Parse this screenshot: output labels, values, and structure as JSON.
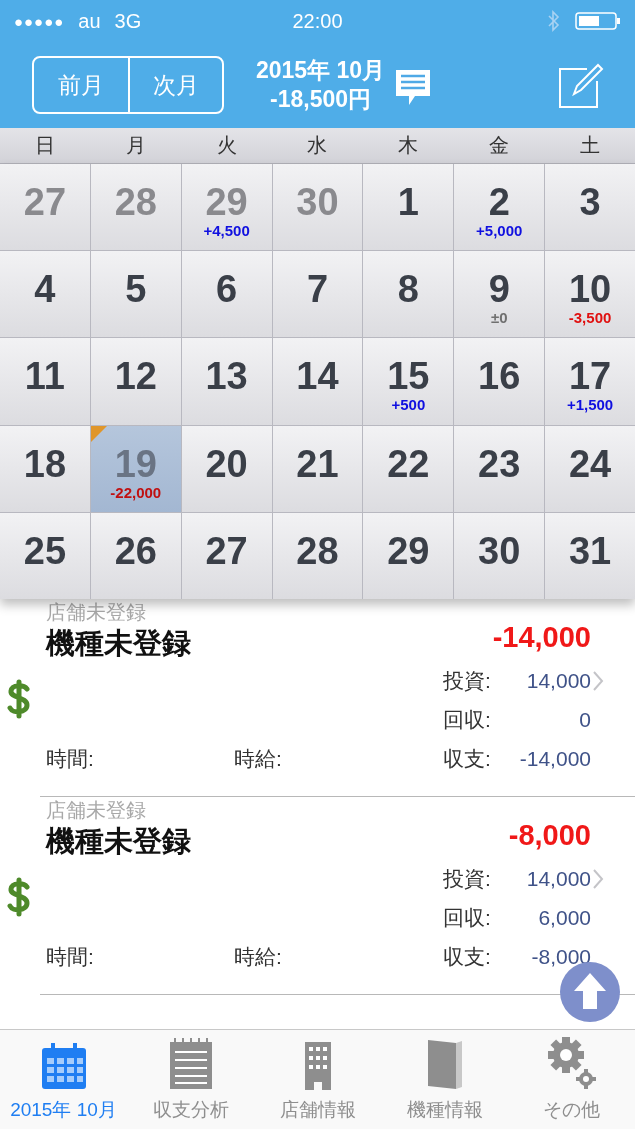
{
  "status_bar": {
    "signal_dots": "●●●●●",
    "carrier": "au",
    "network": "3G",
    "time": "22:00"
  },
  "nav": {
    "prev_button": "前月",
    "next_button": "次月",
    "month": "2015年 10月",
    "total": "-18,500円"
  },
  "weekdays": [
    "日",
    "月",
    "火",
    "水",
    "木",
    "金",
    "土"
  ],
  "days": [
    {
      "day": "27",
      "in_month": false,
      "selected": false,
      "marked": false
    },
    {
      "day": "28",
      "in_month": false,
      "selected": false,
      "marked": false
    },
    {
      "day": "29",
      "in_month": false,
      "selected": false,
      "marked": false,
      "amount": "+4,500",
      "color": "#1010e0"
    },
    {
      "day": "30",
      "in_month": false,
      "selected": false,
      "marked": false
    },
    {
      "day": "1",
      "in_month": true,
      "selected": false,
      "marked": false
    },
    {
      "day": "2",
      "in_month": true,
      "selected": false,
      "marked": false,
      "amount": "+5,000",
      "color": "#1010e0"
    },
    {
      "day": "3",
      "in_month": true,
      "selected": false,
      "marked": false
    },
    {
      "day": "4",
      "in_month": true,
      "selected": false,
      "marked": false
    },
    {
      "day": "5",
      "in_month": true,
      "selected": false,
      "marked": false
    },
    {
      "day": "6",
      "in_month": true,
      "selected": false,
      "marked": false
    },
    {
      "day": "7",
      "in_month": true,
      "selected": false,
      "marked": false
    },
    {
      "day": "8",
      "in_month": true,
      "selected": false,
      "marked": false
    },
    {
      "day": "9",
      "in_month": true,
      "selected": false,
      "marked": false,
      "amount": "±0",
      "color": "#707070"
    },
    {
      "day": "10",
      "in_month": true,
      "selected": false,
      "marked": false,
      "amount": "-3,500",
      "color": "#e01010"
    },
    {
      "day": "11",
      "in_month": true,
      "selected": false,
      "marked": false
    },
    {
      "day": "12",
      "in_month": true,
      "selected": false,
      "marked": false
    },
    {
      "day": "13",
      "in_month": true,
      "selected": false,
      "marked": false
    },
    {
      "day": "14",
      "in_month": true,
      "selected": false,
      "marked": false
    },
    {
      "day": "15",
      "in_month": true,
      "selected": false,
      "marked": false,
      "amount": "+500",
      "color": "#1010e0"
    },
    {
      "day": "16",
      "in_month": true,
      "selected": false,
      "marked": false
    },
    {
      "day": "17",
      "in_month": true,
      "selected": false,
      "marked": false,
      "amount": "+1,500",
      "color": "#1010e0"
    },
    {
      "day": "18",
      "in_month": true,
      "selected": false,
      "marked": false
    },
    {
      "day": "19",
      "in_month": true,
      "selected": true,
      "marked": true,
      "amount": "-22,000",
      "color": "#c01010"
    },
    {
      "day": "20",
      "in_month": true,
      "selected": false,
      "marked": false
    },
    {
      "day": "21",
      "in_month": true,
      "selected": false,
      "marked": false
    },
    {
      "day": "22",
      "in_month": true,
      "selected": false,
      "marked": false
    },
    {
      "day": "23",
      "in_month": true,
      "selected": false,
      "marked": false
    },
    {
      "day": "24",
      "in_month": true,
      "selected": false,
      "marked": false
    },
    {
      "day": "25",
      "in_month": true,
      "selected": false,
      "marked": false
    },
    {
      "day": "26",
      "in_month": true,
      "selected": false,
      "marked": false
    },
    {
      "day": "27",
      "in_month": true,
      "selected": false,
      "marked": false
    },
    {
      "day": "28",
      "in_month": true,
      "selected": false,
      "marked": false
    },
    {
      "day": "29",
      "in_month": true,
      "selected": false,
      "marked": false
    },
    {
      "day": "30",
      "in_month": true,
      "selected": false,
      "marked": false
    },
    {
      "day": "31",
      "in_month": true,
      "selected": false,
      "marked": false
    }
  ],
  "entries": [
    {
      "shop": "店舗未登録",
      "model": "機種未登録",
      "total": "-14,000",
      "invest_label": "投資:",
      "invest": "14,000",
      "recover_label": "回収:",
      "recover": "0",
      "time_label": "時間:",
      "hourly_label": "時給:",
      "balance_label": "収支:",
      "balance": "-14,000"
    },
    {
      "shop": "店舗未登録",
      "model": "機種未登録",
      "total": "-8,000",
      "invest_label": "投資:",
      "invest": "14,000",
      "recover_label": "回収:",
      "recover": "6,000",
      "time_label": "時間:",
      "hourly_label": "時給:",
      "balance_label": "収支:",
      "balance": "-8,000"
    }
  ],
  "tabs": [
    {
      "label": "2015年 10月",
      "kind": "calendar",
      "selected": true
    },
    {
      "label": "収支分析",
      "kind": "notes",
      "selected": false
    },
    {
      "label": "店舗情報",
      "kind": "building",
      "selected": false
    },
    {
      "label": "機種情報",
      "kind": "book",
      "selected": false
    },
    {
      "label": "その他",
      "kind": "gears",
      "selected": false
    }
  ]
}
